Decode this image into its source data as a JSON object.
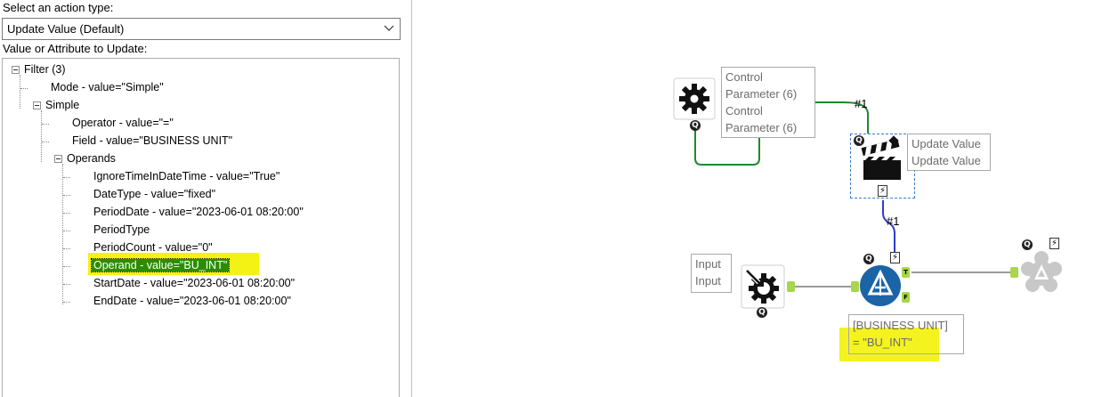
{
  "panel": {
    "action_type_label": "Select an action type:",
    "action_type_value": "Update Value (Default)",
    "update_label": "Value or Attribute to Update:"
  },
  "tree": {
    "filter": "Filter (3)",
    "mode": "Mode - value=\"Simple\"",
    "simple": "Simple",
    "operator": "Operator - value=\"=\"",
    "field": "Field - value=\"BUSINESS UNIT\"",
    "operands": "Operands",
    "ignore_time": "IgnoreTimeInDateTime - value=\"True\"",
    "date_type": "DateType - value=\"fixed\"",
    "period_date": "PeriodDate - value=\"2023-06-01 08:20:00\"",
    "period_type": "PeriodType",
    "period_count": "PeriodCount - value=\"0\"",
    "operand": "Operand - value=\"BU_INT\"",
    "start_date": "StartDate - value=\"2023-06-01 08:20:00\"",
    "end_date": "EndDate - value=\"2023-06-01 08:20:00\""
  },
  "canvas": {
    "control_param_line1": "Control",
    "control_param_line2": "Parameter (6)",
    "control_param_line3": "Control",
    "control_param_line4": "Parameter (6)",
    "update_value_line1": "Update Value",
    "update_value_line2": "Update Value",
    "conn1_label": "#1",
    "conn2_label": "#1",
    "input_line1": "Input",
    "input_line2": "Input",
    "filter_expr_line1": "[BUSINESS UNIT]",
    "filter_expr_line2": "= \"BU_INT\"",
    "anchor_q": "Q",
    "anchor_bolt": "⚡",
    "anchor_true": "T",
    "anchor_false": "F"
  },
  "colors": {
    "selection_green": "#2a8d00",
    "highlight_yellow": "#f3f214",
    "filter_blue": "#1b64a6",
    "connector_green": "#1e8a2e",
    "connector_blue": "#2e3dc9"
  },
  "icons": [
    "chevron-down-icon",
    "gear-icon",
    "clapperboard-icon",
    "filter-icon",
    "macro-input-icon",
    "browse-icon"
  ]
}
